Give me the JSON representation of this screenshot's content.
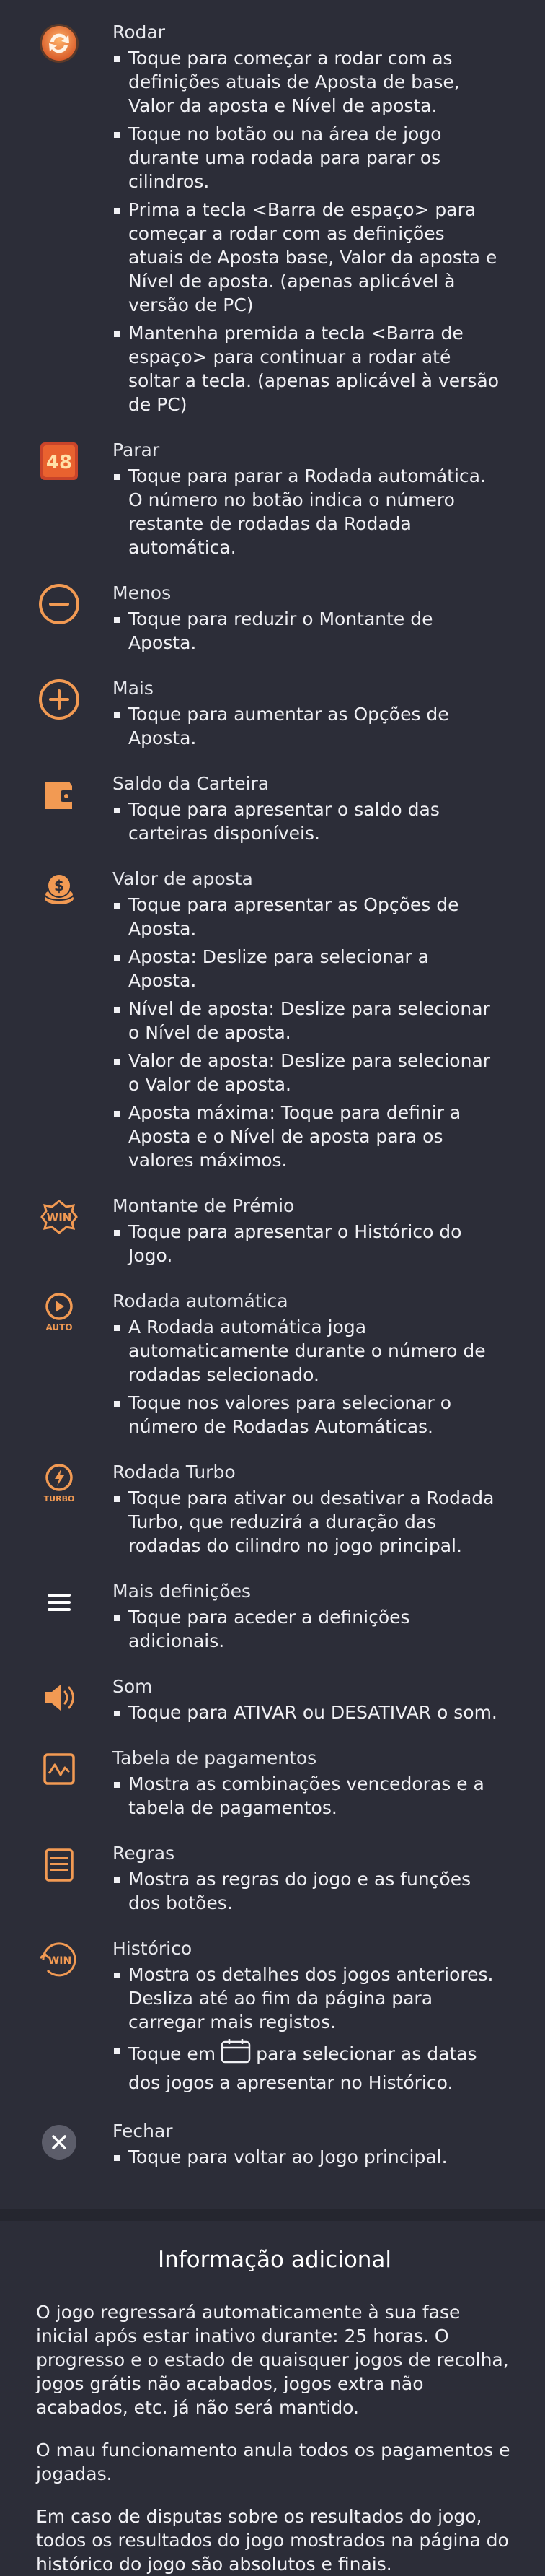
{
  "items": [
    {
      "title": "Rodar",
      "icon": "spin-icon",
      "bullets": [
        "Toque para começar a rodar com as definições atuais de Aposta de base, Valor da aposta e Nível de aposta.",
        "Toque no botão ou na área de jogo durante uma rodada para parar os cilindros.",
        "Prima a tecla <Barra de espaço> para começar a rodar com as definições atuais de Aposta base, Valor da aposta e Nível de aposta. (apenas aplicável à versão de PC)",
        "Mantenha premida a tecla <Barra de espaço> para continuar a rodar até soltar a tecla. (apenas aplicável à versão de PC)"
      ]
    },
    {
      "title": "Parar",
      "icon": "stop-icon",
      "stop_count": "48",
      "bullets": [
        "Toque para parar a Rodada automática. O número no botão indica o número restante de rodadas da Rodada automática."
      ]
    },
    {
      "title": "Menos",
      "icon": "minus-icon",
      "bullets": [
        "Toque para reduzir o Montante de Aposta."
      ]
    },
    {
      "title": "Mais",
      "icon": "plus-icon",
      "bullets": [
        "Toque para aumentar as Opções de Aposta."
      ]
    },
    {
      "title": "Saldo da Carteira",
      "icon": "wallet-icon",
      "bullets": [
        "Toque para apresentar o saldo das carteiras disponíveis."
      ]
    },
    {
      "title": "Valor de aposta",
      "icon": "coins-icon",
      "bullets": [
        "Toque para apresentar as Opções de Aposta.",
        "Aposta: Deslize para selecionar a Aposta.",
        "Nível de aposta: Deslize para selecionar o Nível de aposta.",
        "Valor de aposta: Deslize para selecionar o Valor de aposta.",
        "Aposta máxima: Toque para definir a Aposta e o Nível de aposta para os valores máximos."
      ]
    },
    {
      "title": "Montante de Prémio",
      "icon": "win-icon",
      "icon_text": "WIN",
      "bullets": [
        "Toque para apresentar o Histórico do Jogo."
      ]
    },
    {
      "title": "Rodada automática",
      "icon": "auto-play-icon",
      "icon_text": "AUTO",
      "bullets": [
        "A Rodada automática joga automaticamente durante o número de rodadas selecionado.",
        "Toque nos valores para selecionar o número de Rodadas Automáticas."
      ]
    },
    {
      "title": "Rodada Turbo",
      "icon": "turbo-icon",
      "icon_text": "TURBO",
      "bullets": [
        "Toque para ativar ou desativar a Rodada Turbo, que reduzirá a duração das rodadas do cilindro no jogo principal."
      ]
    },
    {
      "title": "Mais definições",
      "icon": "menu-icon",
      "bullets": [
        "Toque para aceder a definições adicionais."
      ]
    },
    {
      "title": "Som",
      "icon": "sound-icon",
      "bullets": [
        "Toque para ATIVAR ou DESATIVAR o som."
      ]
    },
    {
      "title": "Tabela de pagamentos",
      "icon": "paytable-icon",
      "bullets": [
        "Mostra as combinações vencedoras e a tabela de pagamentos."
      ]
    },
    {
      "title": "Regras",
      "icon": "rules-icon",
      "bullets": [
        "Mostra as regras do jogo e as funções dos botões."
      ]
    },
    {
      "title": "Histórico",
      "icon": "history-icon",
      "icon_text": "WIN",
      "bullets": [
        "Mostra os detalhes dos jogos anteriores. Desliza até ao fim da página para carregar mais registos."
      ],
      "calendar_before": "Toque em",
      "calendar_after": "para selecionar as datas dos jogos a apresentar no Histórico."
    },
    {
      "title": "Fechar",
      "icon": "close-icon",
      "bullets": [
        "Toque para voltar ao Jogo principal."
      ]
    }
  ],
  "additional": {
    "title": "Informação adicional",
    "paragraphs": [
      "O jogo regressará automaticamente à sua fase inicial após estar inativo durante: 25 horas. O progresso e o estado de quaisquer jogos de recolha, jogos grátis não acabados, jogos extra não acabados, etc. já não será mantido.",
      "O mau funcionamento anula todos os pagamentos e jogadas.",
      "Em caso de disputas sobre os resultados do jogo, todos os resultados do jogo mostrados na página do histórico do jogo são absolutos e finais."
    ]
  },
  "colors": {
    "accent": "#f29a53",
    "background": "#2c2d38",
    "text": "#f0f0f4"
  }
}
